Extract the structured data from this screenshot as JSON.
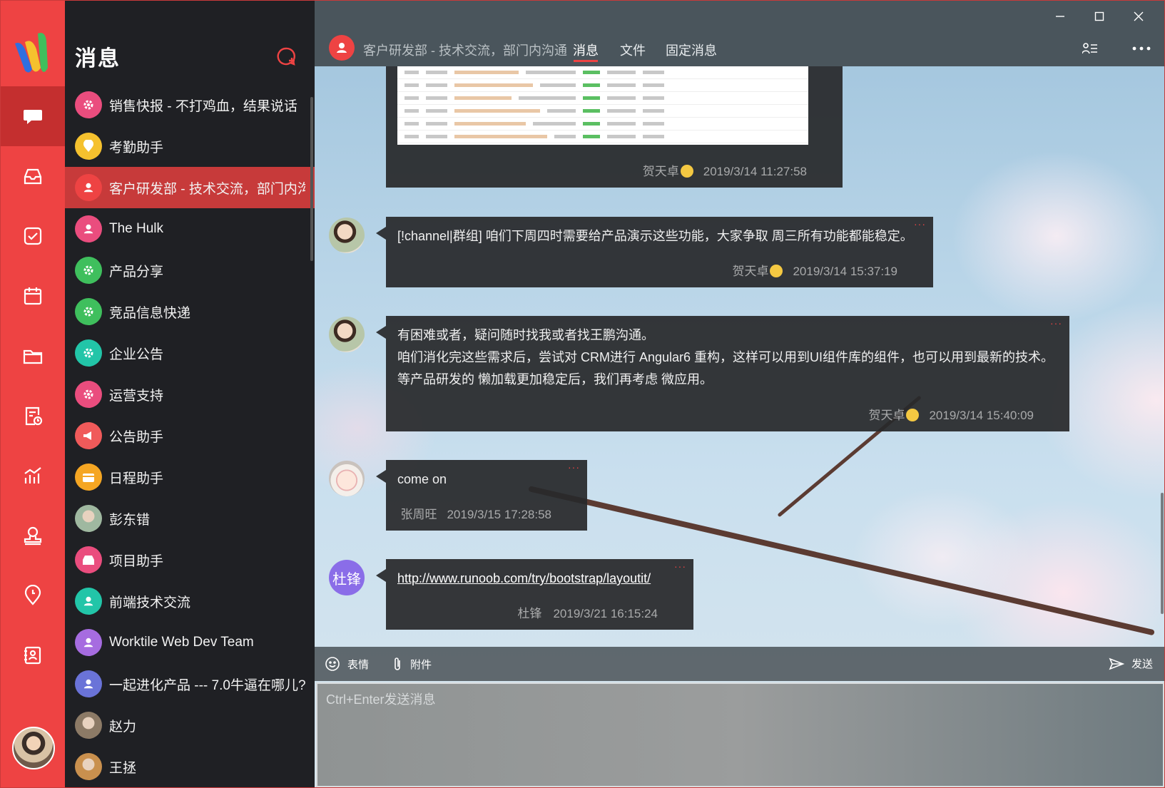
{
  "colors": {
    "accent": "#ee4343",
    "rail": "#ee4343",
    "sidebar_bg": "#1f2024",
    "active_conv": "#c73a3a",
    "bubble": "#28292b"
  },
  "sidebar": {
    "title": "消息",
    "conversations": [
      {
        "name": "销售快报 - 不打鸡血，结果说话",
        "icon": "gear-icon",
        "color": "#ea4d7e"
      },
      {
        "name": "考勤助手",
        "icon": "location-icon",
        "color": "#f5c12e"
      },
      {
        "name": "客户研发部 - 技术交流，部门内沟通",
        "icon": "people-icon",
        "color": "#ee4343",
        "active": true
      },
      {
        "name": "The Hulk",
        "icon": "people-icon",
        "color": "#ea4d7e"
      },
      {
        "name": "产品分享",
        "icon": "gear-icon",
        "color": "#3fbf5d"
      },
      {
        "name": "竞品信息快递",
        "icon": "gear-icon",
        "color": "#3fbf5d"
      },
      {
        "name": "企业公告",
        "icon": "gear-icon",
        "color": "#22c5a8"
      },
      {
        "name": "运营支持",
        "icon": "gear-icon",
        "color": "#ea4d7e"
      },
      {
        "name": "公告助手",
        "icon": "megaphone-icon",
        "color": "#f05a5a"
      },
      {
        "name": "日程助手",
        "icon": "calendar-icon",
        "color": "#f5a623"
      },
      {
        "name": "彭东错",
        "icon": "user-avatar",
        "color": "#9fb8a0"
      },
      {
        "name": "项目助手",
        "icon": "inbox-icon",
        "color": "#ea4d7e"
      },
      {
        "name": "前端技术交流",
        "icon": "people-icon",
        "color": "#22c5a8"
      },
      {
        "name": "Worktile Web Dev Team",
        "icon": "people-icon",
        "color": "#a66ce0"
      },
      {
        "name": "一起进化产品 --- 7.0牛逼在哪儿?",
        "icon": "people-icon",
        "color": "#6a73d8"
      },
      {
        "name": "赵力",
        "icon": "user-avatar",
        "color": "#8c7a66"
      },
      {
        "name": "王拯",
        "icon": "user-avatar",
        "color": "#c9904e"
      }
    ]
  },
  "header": {
    "title": "客户研发部 - 技术交流，部门内沟通",
    "tabs": [
      "消息",
      "文件",
      "固定消息"
    ],
    "active_tab": "消息"
  },
  "messages": [
    {
      "author": "贺天卓",
      "time": "2019/3/14 11:27:58",
      "type": "image"
    },
    {
      "author": "贺天卓",
      "time": "2019/3/14 15:37:19",
      "lines": [
        "[!channel|群组] 咱们下周四时需要给产品演示这些功能，大家争取 周三所有功能都能稳定。"
      ]
    },
    {
      "author": "贺天卓",
      "time": "2019/3/14 15:40:09",
      "lines": [
        "有困难或者，疑问随时找我或者找王鹏沟通。",
        "咱们消化完这些需求后，尝试对 CRM进行 Angular6 重构，这样可以用到UI组件库的组件，也可以用到最新的技术。",
        "等产品研发的 懒加载更加稳定后，我们再考虑 微应用。"
      ]
    },
    {
      "author": "张周旺",
      "time": "2019/3/15 17:28:58",
      "lines": [
        "come on"
      ]
    },
    {
      "author": "杜锋",
      "avatar_text": "杜锋",
      "time": "2019/3/21 16:15:24",
      "link": "http://www.runoob.com/try/bootstrap/layoutit/"
    }
  ],
  "composer": {
    "emoji_label": "表情",
    "attach_label": "附件",
    "send_label": "发送",
    "placeholder": "Ctrl+Enter发送消息"
  }
}
